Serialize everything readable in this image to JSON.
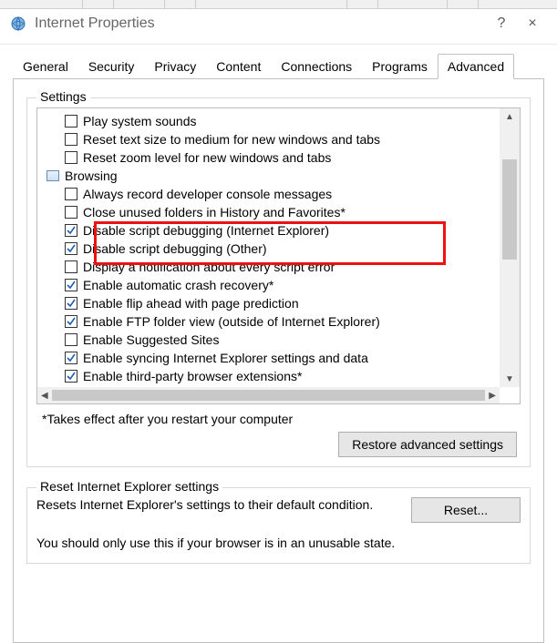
{
  "window": {
    "title": "Internet Properties",
    "help_label": "?",
    "close_label": "×"
  },
  "tabs": [
    {
      "label": "General",
      "active": false
    },
    {
      "label": "Security",
      "active": false
    },
    {
      "label": "Privacy",
      "active": false
    },
    {
      "label": "Content",
      "active": false
    },
    {
      "label": "Connections",
      "active": false
    },
    {
      "label": "Programs",
      "active": false
    },
    {
      "label": "Advanced",
      "active": true
    }
  ],
  "settings_group_label": "Settings",
  "settings_items": [
    {
      "type": "item",
      "label": "Play system sounds",
      "checked": false
    },
    {
      "type": "item",
      "label": "Reset text size to medium for new windows and tabs",
      "checked": false
    },
    {
      "type": "item",
      "label": "Reset zoom level for new windows and tabs",
      "checked": false
    },
    {
      "type": "group",
      "label": "Browsing"
    },
    {
      "type": "item",
      "label": "Always record developer console messages",
      "checked": false
    },
    {
      "type": "item",
      "label": "Close unused folders in History and Favorites*",
      "checked": false
    },
    {
      "type": "item",
      "label": "Disable script debugging (Internet Explorer)",
      "checked": true,
      "highlighted": true
    },
    {
      "type": "item",
      "label": "Disable script debugging (Other)",
      "checked": true,
      "highlighted": true
    },
    {
      "type": "item",
      "label": "Display a notification about every script error",
      "checked": false
    },
    {
      "type": "item",
      "label": "Enable automatic crash recovery*",
      "checked": true
    },
    {
      "type": "item",
      "label": "Enable flip ahead with page prediction",
      "checked": true
    },
    {
      "type": "item",
      "label": "Enable FTP folder view (outside of Internet Explorer)",
      "checked": true
    },
    {
      "type": "item",
      "label": "Enable Suggested Sites",
      "checked": false
    },
    {
      "type": "item",
      "label": "Enable syncing Internet Explorer settings and data",
      "checked": true
    },
    {
      "type": "item",
      "label": "Enable third-party browser extensions*",
      "checked": true
    }
  ],
  "restart_note": "*Takes effect after you restart your computer",
  "restore_button_label": "Restore advanced settings",
  "reset_group_label": "Reset Internet Explorer settings",
  "reset_text": "Resets Internet Explorer's settings to their default condition.",
  "reset_button_label": "Reset...",
  "reset_note": "You should only use this if your browser is in an unusable state."
}
